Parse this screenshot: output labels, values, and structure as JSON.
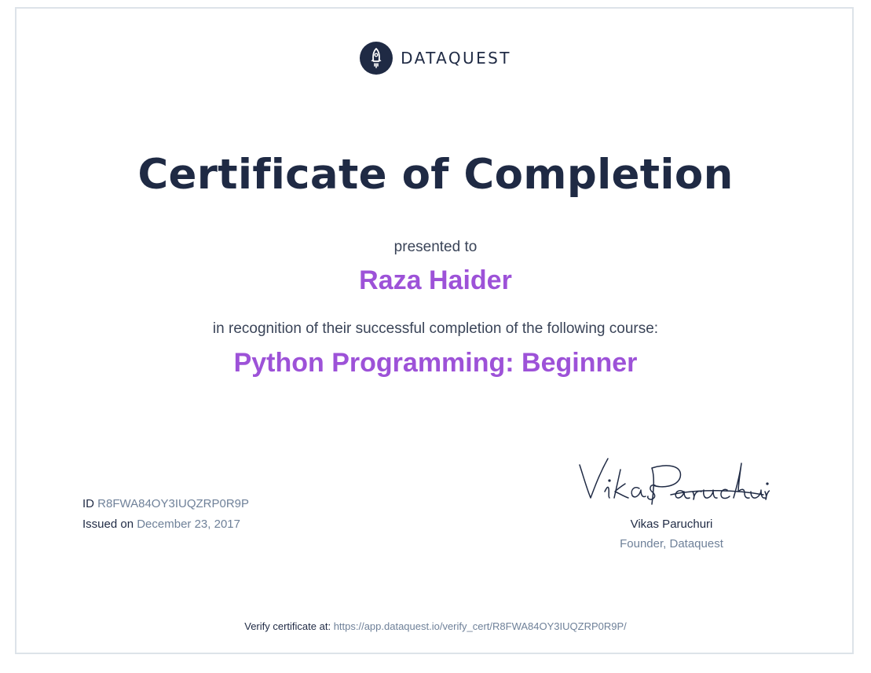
{
  "brand": {
    "name": "DATAQUEST",
    "icon": "rocket-icon",
    "badge_color": "#1f2a44"
  },
  "certificate": {
    "title": "Certificate of Completion",
    "presented_to_label": "presented to",
    "recipient": "Raza Haider",
    "recognition_text": "in recognition of their successful completion of the following course:",
    "course": "Python Programming: Beginner",
    "accent_color": "#9d52d8"
  },
  "details": {
    "id_label": "ID",
    "id_value": "R8FWA84OY3IUQZRP0R9P",
    "issued_label": "Issued on",
    "issued_value": "December 23, 2017"
  },
  "signatory": {
    "signature": "Vikas Paruchuri",
    "name": "Vikas Paruchuri",
    "role": "Founder, Dataquest"
  },
  "verify": {
    "label": "Verify certificate at:",
    "url": "https://app.dataquest.io/verify_cert/R8FWA84OY3IUQZRP0R9P/"
  }
}
